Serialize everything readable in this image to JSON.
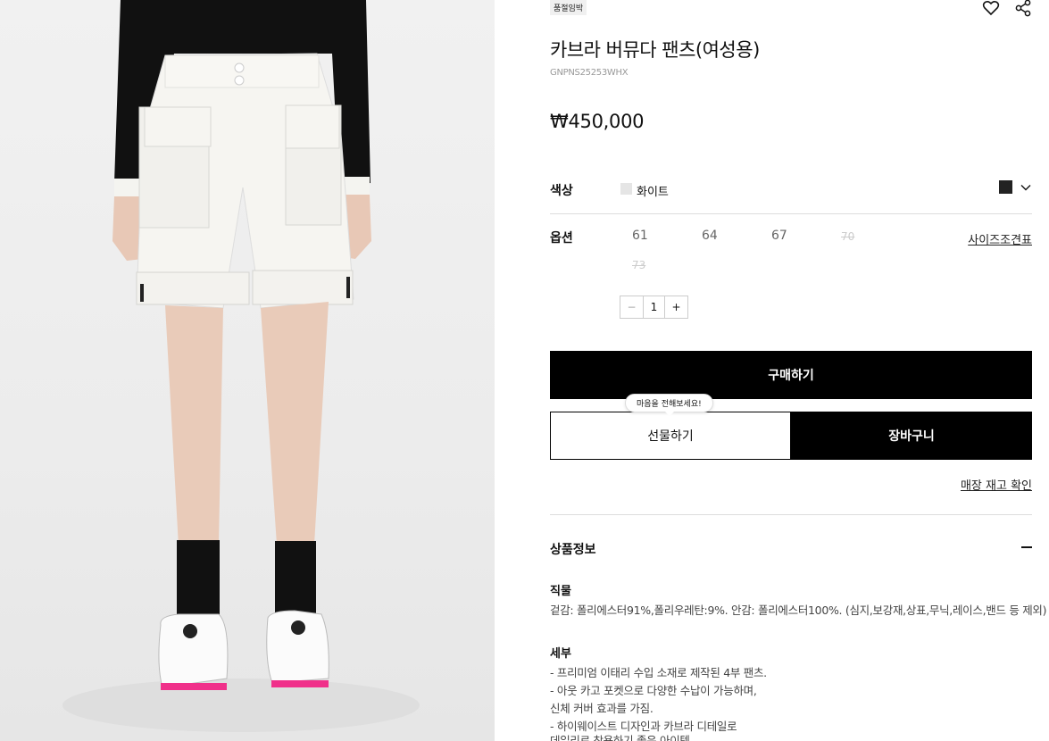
{
  "badge": "품절임박",
  "title": "카브라 버뮤다 팬츠(여성용)",
  "code": "GNPNS25253WHX",
  "price": "₩450,000",
  "color": {
    "label": "색상",
    "name": "화이트",
    "chip_color": "#e5e5e5",
    "alt_swatch_color": "#222222"
  },
  "option": {
    "label": "옵션",
    "sizes": [
      {
        "value": "61",
        "soldout": false
      },
      {
        "value": "64",
        "soldout": false
      },
      {
        "value": "67",
        "soldout": false
      },
      {
        "value": "70",
        "soldout": true
      },
      {
        "value": "73",
        "soldout": true
      }
    ],
    "size_chart": "사이즈조견표"
  },
  "quantity": {
    "minus": "−",
    "value": "1",
    "plus": "+"
  },
  "buttons": {
    "buy": "구매하기",
    "gift": "선물하기",
    "cart": "장바구니",
    "gift_tooltip": "마음을 전해보세요!"
  },
  "store_link": "매장 재고 확인",
  "info": {
    "heading": "상품정보",
    "material_heading": "직물",
    "material_text": "겉감: 폴리에스터91%,폴리우레탄:9%. 안감: 폴리에스터100%. (심지,보강재,상표,무닉,레이스,밴드 등 제외)",
    "detail_heading": "세부",
    "detail_lines": [
      "- 프리미엄 이태리 수입 소재로 제작된 4부 팬츠.",
      "- 아웃 카고 포켓으로 다양한 수납이 가능하며,",
      "신체 커버 효과를 가짐.",
      "- 하이웨이스트 디자인과 카브라 디테일로",
      "데일리로 착용하기 좋은 아이템."
    ]
  }
}
